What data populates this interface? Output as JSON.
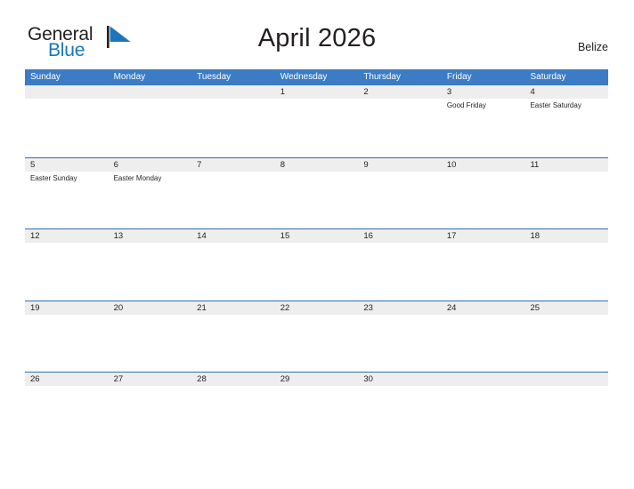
{
  "brand": {
    "name_part1": "General",
    "name_part2": "Blue",
    "flag_icon": "blue-triangle-flag-icon",
    "colors": {
      "text": "#231f20",
      "blue": "#1b75bb"
    }
  },
  "header": {
    "title": "April 2026",
    "region": "Belize"
  },
  "calendar": {
    "colors": {
      "header_blue": "#3c7cc4",
      "row_border_blue": "#2f6fb0",
      "date_band_gray": "#eeeeee"
    },
    "weekdays": [
      "Sunday",
      "Monday",
      "Tuesday",
      "Wednesday",
      "Thursday",
      "Friday",
      "Saturday"
    ],
    "weeks": [
      [
        {
          "date": "",
          "events": []
        },
        {
          "date": "",
          "events": []
        },
        {
          "date": "",
          "events": []
        },
        {
          "date": "1",
          "events": []
        },
        {
          "date": "2",
          "events": []
        },
        {
          "date": "3",
          "events": [
            "Good Friday"
          ]
        },
        {
          "date": "4",
          "events": [
            "Easter Saturday"
          ]
        }
      ],
      [
        {
          "date": "5",
          "events": [
            "Easter Sunday"
          ]
        },
        {
          "date": "6",
          "events": [
            "Easter Monday"
          ]
        },
        {
          "date": "7",
          "events": []
        },
        {
          "date": "8",
          "events": []
        },
        {
          "date": "9",
          "events": []
        },
        {
          "date": "10",
          "events": []
        },
        {
          "date": "11",
          "events": []
        }
      ],
      [
        {
          "date": "12",
          "events": []
        },
        {
          "date": "13",
          "events": []
        },
        {
          "date": "14",
          "events": []
        },
        {
          "date": "15",
          "events": []
        },
        {
          "date": "16",
          "events": []
        },
        {
          "date": "17",
          "events": []
        },
        {
          "date": "18",
          "events": []
        }
      ],
      [
        {
          "date": "19",
          "events": []
        },
        {
          "date": "20",
          "events": []
        },
        {
          "date": "21",
          "events": []
        },
        {
          "date": "22",
          "events": []
        },
        {
          "date": "23",
          "events": []
        },
        {
          "date": "24",
          "events": []
        },
        {
          "date": "25",
          "events": []
        }
      ],
      [
        {
          "date": "26",
          "events": []
        },
        {
          "date": "27",
          "events": []
        },
        {
          "date": "28",
          "events": []
        },
        {
          "date": "29",
          "events": []
        },
        {
          "date": "30",
          "events": []
        },
        {
          "date": "",
          "events": []
        },
        {
          "date": "",
          "events": []
        }
      ]
    ]
  }
}
